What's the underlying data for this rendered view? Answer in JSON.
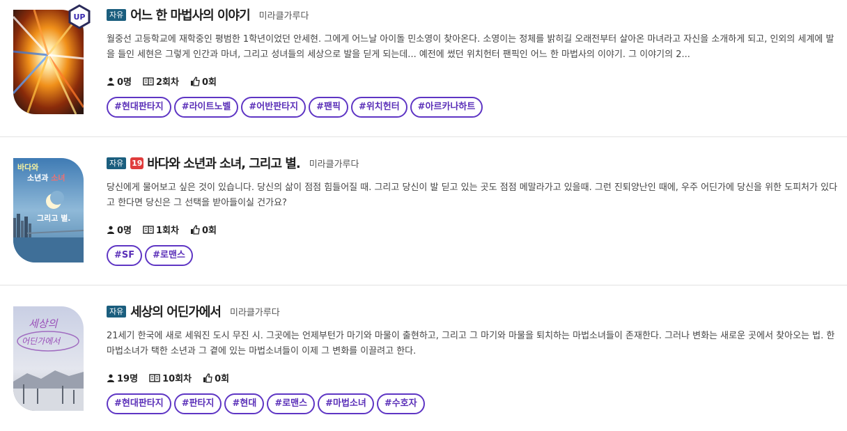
{
  "novels": [
    {
      "badge_free": "자유",
      "badge_up": "UP",
      "title": "어느 한 마법사의 이야기",
      "author": "미라클가루다",
      "description": "월중선 고등학교에 재학중인 평범한 1학년이었던 안세현. 그에게 어느날 아이돌 민소영이 찾아온다. 소영이는 정체를 밝히길 오래전부터 살아온 마녀라고 자신을 소개하게 되고, 인외의 세계에 발을 들인 세현은 그렇게 인간과 마녀, 그리고 성녀들의 세상으로 발을 딛게 되는데... 예전에 썼던 위치헌터 팬픽인 어느 한 마법사의 이야기. 그 이야기의 2...",
      "readers": "0명",
      "episodes": "2회차",
      "likes": "0회",
      "tags": [
        "#현대판타지",
        "#라이트노벨",
        "#어반판타지",
        "#팬픽",
        "#위치헌터",
        "#아르카나하트"
      ]
    },
    {
      "badge_free": "자유",
      "badge_age": "19",
      "title": "바다와 소년과 소녀, 그리고 별.",
      "author": "미라클가루다",
      "cover_text_1": "바다와",
      "cover_text_2a": "소년과 ",
      "cover_text_2b": "소녀",
      "cover_text_3": "그리고 별.",
      "description": "당신에게 물어보고 싶은 것이 있습니다. 당신의 삶이 점점 힘들어질 때. 그리고 당신이 발 딛고 있는 곳도 점점 메말라가고 있을때. 그런 진퇴양난인 때에, 우주 어딘가에 당신을 위한 도피처가 있다고 한다면 당신은 그 선택을 받아들이실 건가요?",
      "readers": "0명",
      "episodes": "1회차",
      "likes": "0회",
      "tags": [
        "#SF",
        "#로맨스"
      ]
    },
    {
      "badge_free": "자유",
      "title": "세상의 어딘가에서",
      "author": "미라클가루다",
      "cover_text_1": "세상의",
      "cover_text_2": "어딘가에서",
      "description": "21세기 한국에 새로 세워진 도시 무진 시. 그곳에는 언제부턴가 마기와 마물이 출현하고, 그리고 그 마기와 마물을 퇴치하는 마법소녀들이 존재한다. 그러나 변화는 새로운 곳에서 찾아오는 법. 한 마법소녀가 택한 소년과 그 곁에 있는 마법소녀들이 이제 그 변화를 이끌려고 한다.",
      "readers": "19명",
      "episodes": "10회차",
      "likes": "0회",
      "tags": [
        "#현대판타지",
        "#판타지",
        "#현대",
        "#로맨스",
        "#마법소녀",
        "#수호자"
      ]
    }
  ],
  "colors": {
    "free_badge": "#1b5e7e",
    "age_badge": "#e03c3c",
    "hashtag": "#5e35c4"
  },
  "icons": {
    "readers": "person-icon",
    "episodes": "book-icon",
    "likes": "thumbs-up-icon",
    "up": "up-hexagon-icon"
  }
}
